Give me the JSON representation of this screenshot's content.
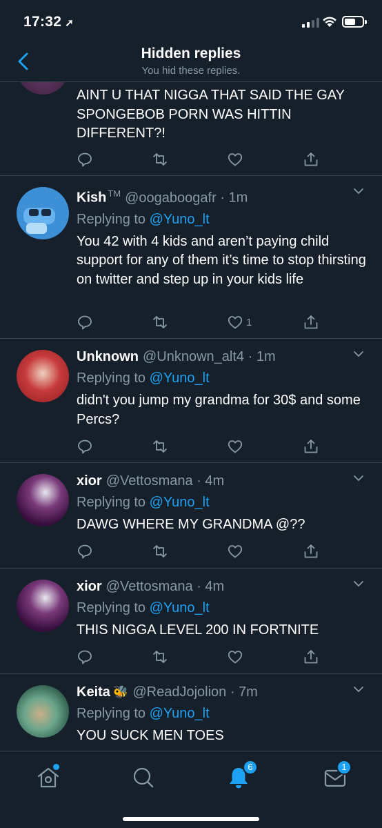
{
  "status_bar": {
    "time": "17:32"
  },
  "header": {
    "title": "Hidden replies",
    "subtitle": "You hid these replies."
  },
  "tweets": [
    {
      "body": "AINT U THAT NIGGA THAT SAID THE GAY SPONGEBOB PORN WAS HITTIN DIFFERENT?!"
    },
    {
      "name": "Kish",
      "badge": "TM",
      "handle": "@oogaboogafr",
      "time": "· 1m",
      "replying_prefix": "Replying to",
      "replying_to": "@Yuno_lt",
      "body": "You 42 with 4 kids and aren’t paying child support for any of them it’s time to stop thirsting on twitter and step up in your kids life",
      "like_count": "1"
    },
    {
      "name": "Unknown",
      "handle": "@Unknown_alt4",
      "time": "· 1m",
      "replying_prefix": "Replying to",
      "replying_to": "@Yuno_lt",
      "body": "didn't you jump my grandma for 30$ and some Percs?"
    },
    {
      "name": "xior",
      "handle": "@Vettosmana",
      "time": "· 4m",
      "replying_prefix": "Replying to",
      "replying_to": "@Yuno_lt",
      "body": "DAWG WHERE MY GRANDMA @??"
    },
    {
      "name": "xior",
      "handle": "@Vettosmana",
      "time": "· 4m",
      "replying_prefix": "Replying to",
      "replying_to": "@Yuno_lt",
      "body": "THIS NIGGA LEVEL 200 IN FORTNITE"
    },
    {
      "name": "Keita",
      "emoji": "🐝",
      "handle": "@ReadJojolion",
      "time": "· 7m",
      "replying_prefix": "Replying to",
      "replying_to": "@Yuno_lt",
      "body": "YOU SUCK MEN TOES"
    }
  ],
  "tab_bar": {
    "notifications_badge": "6",
    "messages_badge": "1"
  },
  "colors": {
    "background": "#15202b",
    "accent": "#1da1f2",
    "secondary_text": "#8899a6",
    "divider": "#38444d"
  },
  "icons": [
    "back-chevron-icon",
    "reply-icon",
    "retweet-icon",
    "like-icon",
    "share-icon",
    "home-icon",
    "search-icon",
    "notifications-bell-icon",
    "messages-envelope-icon"
  ]
}
